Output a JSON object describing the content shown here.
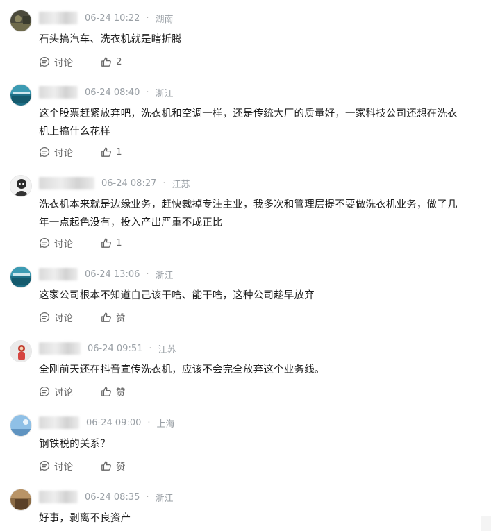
{
  "comments": [
    {
      "time": "06-24 10:22",
      "region": "湖南",
      "text": "石头搞汽车、洗衣机就是瞎折腾",
      "discuss_label": "讨论",
      "like_label": "2"
    },
    {
      "time": "06-24 08:40",
      "region": "浙江",
      "text": "这个股票赶紧放弃吧，洗衣机和空调一样，还是传统大厂的质量好，一家科技公司还想在洗衣机上搞什么花样",
      "discuss_label": "讨论",
      "like_label": "1"
    },
    {
      "time": "06-24 08:27",
      "region": "江苏",
      "text": "洗衣机本来就是边缘业务，赶快裁掉专注主业，我多次和管理层提不要做洗衣机业务，做了几年一点起色没有，投入产出严重不成正比",
      "discuss_label": "讨论",
      "like_label": "1"
    },
    {
      "time": "06-24 13:06",
      "region": "浙江",
      "text": "这家公司根本不知道自己该干啥、能干啥，这种公司趁早放弃",
      "discuss_label": "讨论",
      "like_label": "赞"
    },
    {
      "time": "06-24 09:51",
      "region": "江苏",
      "text": "全刚前天还在抖音宣传洗衣机，应该不会完全放弃这个业务线。",
      "discuss_label": "讨论",
      "like_label": "赞"
    },
    {
      "time": "06-24 09:00",
      "region": "上海",
      "text": "钢铁税的关系？",
      "discuss_label": "讨论",
      "like_label": "赞"
    },
    {
      "time": "06-24 08:35",
      "region": "浙江",
      "text": "好事，剥离不良资产"
    }
  ],
  "icons": {
    "discuss": "discuss-bubble-icon",
    "like": "thumbs-up-icon"
  },
  "colors": {
    "meta_gray": "#9aa0a6",
    "body_text": "#1f1f1f",
    "action_gray": "#666666"
  }
}
